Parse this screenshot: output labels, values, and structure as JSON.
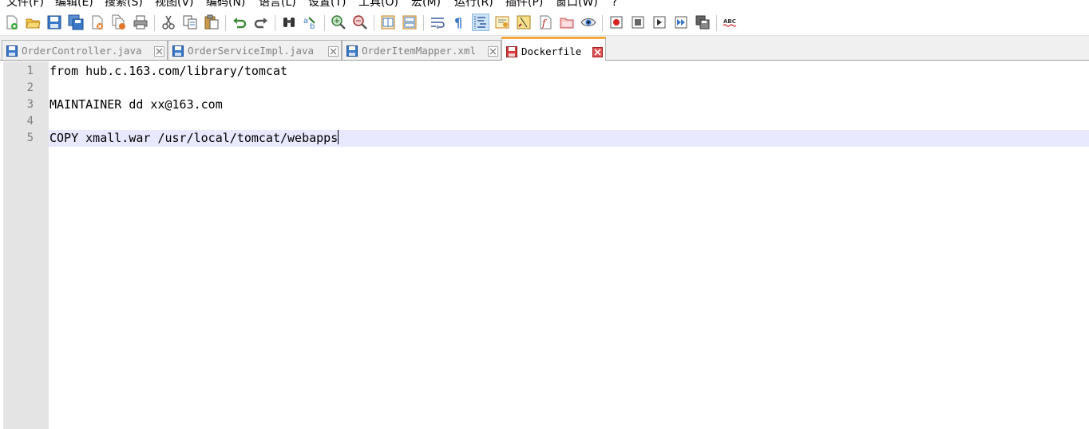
{
  "menu": [
    {
      "label": "文件(F)"
    },
    {
      "label": "编辑(E)"
    },
    {
      "label": "搜索(S)"
    },
    {
      "label": "视图(V)"
    },
    {
      "label": "编码(N)"
    },
    {
      "label": "语言(L)"
    },
    {
      "label": "设置(T)"
    },
    {
      "label": "工具(O)"
    },
    {
      "label": "宏(M)"
    },
    {
      "label": "运行(R)"
    },
    {
      "label": "插件(P)"
    },
    {
      "label": "窗口(W)"
    },
    {
      "label": "?"
    }
  ],
  "toolbar": {
    "buttons": [
      "new",
      "open",
      "save",
      "save-all",
      "close",
      "close-all",
      "print",
      "cut",
      "copy",
      "paste",
      "undo",
      "redo",
      "find",
      "replace",
      "zoom-in",
      "zoom-out",
      "sync-vertical",
      "sync-horizontal",
      "word-wrap",
      "show-all-characters",
      "indent-guide",
      "user-language",
      "doc-map",
      "function-list",
      "folder-as-workspace",
      "monitoring",
      "record-macro",
      "stop-recording",
      "play-macro",
      "run-macro-multiple",
      "save-macro",
      "spell-check"
    ],
    "spell_check_text": "ABC"
  },
  "tabs": [
    {
      "label": "OrderController.java",
      "state": "saved",
      "active": false
    },
    {
      "label": "OrderServiceImpl.java",
      "state": "saved",
      "active": false
    },
    {
      "label": "OrderItemMapper.xml",
      "state": "saved",
      "active": false
    },
    {
      "label": "Dockerfile",
      "state": "unsaved",
      "active": true
    }
  ],
  "editor": {
    "lines": [
      {
        "num": "1",
        "text": "from hub.c.163.com/library/tomcat"
      },
      {
        "num": "2",
        "text": ""
      },
      {
        "num": "3",
        "text": "MAINTAINER dd xx@163.com"
      },
      {
        "num": "4",
        "text": ""
      },
      {
        "num": "5",
        "text": "COPY xmall.war /usr/local/tomcat/webapps"
      }
    ],
    "current_line": 5
  },
  "colors": {
    "tab_active_accent": "#f3a93c",
    "current_line_highlight": "#e8e8ff",
    "saved_icon": "#3a78c8",
    "unsaved_icon": "#d83a3a"
  }
}
